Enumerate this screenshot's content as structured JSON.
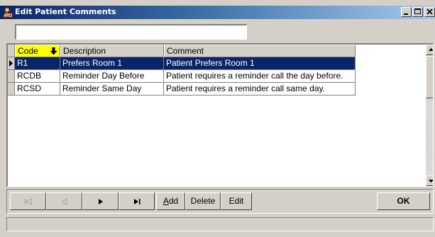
{
  "window": {
    "title": "Edit Patient Comments",
    "icons": {
      "app": "patient-app-icon",
      "minimize": "minimize-icon",
      "maximize": "maximize-icon",
      "close": "close-icon"
    }
  },
  "search": {
    "value": "",
    "placeholder": ""
  },
  "grid": {
    "columns": [
      {
        "label": "Code",
        "sort_icon": "sort-down-arrow-icon",
        "accent": "#ffff00"
      },
      {
        "label": "Description"
      },
      {
        "label": "Comment"
      }
    ],
    "rows": [
      {
        "code": "R1",
        "description": "Prefers Room 1",
        "comment": "Patient Prefers Room 1",
        "selected": true
      },
      {
        "code": "RCDB",
        "description": "Reminder Day Before",
        "comment": "Patient requires a reminder call the day before.",
        "selected": false
      },
      {
        "code": "RCSD",
        "description": "Reminder Same Day",
        "comment": "Patient requires a reminder call same day.",
        "selected": false
      }
    ],
    "selection_color": "#0a246a",
    "current_row_icon": "current-row-arrow-icon"
  },
  "nav": {
    "first": {
      "icon": "first-record-icon",
      "enabled": false
    },
    "prev": {
      "icon": "prev-record-icon",
      "enabled": false
    },
    "next": {
      "icon": "next-record-icon",
      "enabled": true
    },
    "last": {
      "icon": "last-record-icon",
      "enabled": true
    }
  },
  "actions": {
    "add_label_hotkey": "A",
    "add_label_rest": "dd",
    "delete_label": "Delete",
    "edit_label": "Edit",
    "ok_label": "OK"
  },
  "colors": {
    "face": "#d4d0c8",
    "title_start": "#0a246a",
    "title_end": "#a6caf0"
  }
}
